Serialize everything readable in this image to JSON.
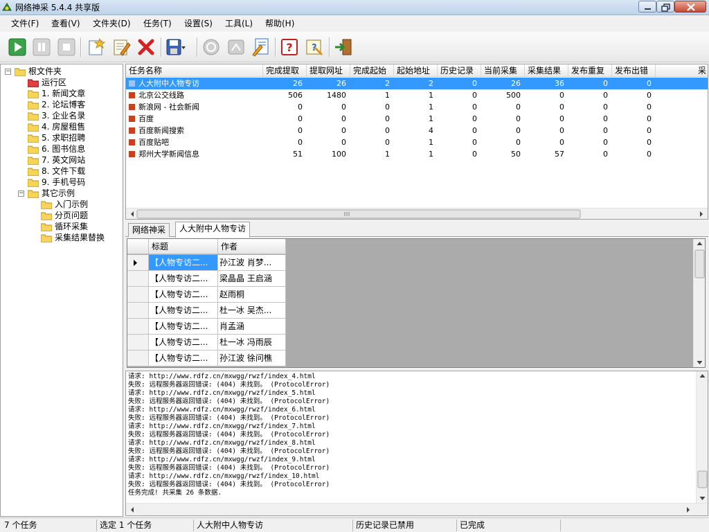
{
  "window": {
    "title": "网络神采 5.4.4 共享版"
  },
  "menu": [
    {
      "label": "文件(F)"
    },
    {
      "label": "查看(V)"
    },
    {
      "label": "文件夹(D)"
    },
    {
      "label": "任务(T)"
    },
    {
      "label": "设置(S)"
    },
    {
      "label": "工具(L)"
    },
    {
      "label": "帮助(H)"
    }
  ],
  "toolbar_icons": [
    "start-icon",
    "pause-icon",
    "stop-icon",
    "new-task-icon",
    "edit-task-icon",
    "delete-task-icon",
    "save-icon",
    "disabled-run-icon",
    "disabled-export-icon",
    "wizard-icon",
    "help-icon",
    "search-help-icon",
    "exit-icon"
  ],
  "tree": {
    "root": "根文件夹",
    "items": [
      {
        "label": "运行区"
      },
      {
        "label": "1. 新闻文章"
      },
      {
        "label": "2. 论坛博客"
      },
      {
        "label": "3. 企业名录"
      },
      {
        "label": "4. 房屋租售"
      },
      {
        "label": "5. 求职招聘"
      },
      {
        "label": "6. 图书信息"
      },
      {
        "label": "7. 英文网站"
      },
      {
        "label": "8. 文件下载"
      },
      {
        "label": "9. 手机号码"
      }
    ],
    "other": "其它示例",
    "sub_items": [
      {
        "label": "入门示例"
      },
      {
        "label": "分页问题"
      },
      {
        "label": "循环采集"
      },
      {
        "label": "采集结果替换"
      }
    ]
  },
  "task_table": {
    "columns": [
      "任务名称",
      "完成提取",
      "提取网址",
      "完成起始",
      "起始地址",
      "历史记录",
      "当前采集",
      "采集结果",
      "发布重复",
      "发布出错",
      "采"
    ],
    "rows": [
      [
        "人大附中人物专访",
        "26",
        "26",
        "2",
        "2",
        "0",
        "26",
        "36",
        "0",
        "0"
      ],
      [
        "北京公交线路",
        "506",
        "1480",
        "1",
        "1",
        "0",
        "500",
        "0",
        "0",
        "0"
      ],
      [
        "新浪网 - 社会新闻",
        "0",
        "0",
        "0",
        "1",
        "0",
        "0",
        "0",
        "0",
        "0"
      ],
      [
        "百度",
        "0",
        "0",
        "0",
        "1",
        "0",
        "0",
        "0",
        "0",
        "0"
      ],
      [
        "百度新闻搜索",
        "0",
        "0",
        "0",
        "4",
        "0",
        "0",
        "0",
        "0",
        "0"
      ],
      [
        "百度贴吧",
        "0",
        "0",
        "0",
        "1",
        "0",
        "0",
        "0",
        "0",
        "0"
      ],
      [
        "郑州大学新闻信息",
        "51",
        "100",
        "1",
        "1",
        "0",
        "50",
        "57",
        "0",
        "0"
      ]
    ]
  },
  "tabs": [
    {
      "label": "网络神采"
    },
    {
      "label": "人大附中人物专访"
    }
  ],
  "result_table": {
    "columns": [
      "标题",
      "作者"
    ],
    "rows": [
      [
        "【人物专访二...",
        "孙江波  肖梦..."
      ],
      [
        "【人物专访二...",
        "梁晶晶 王启涵"
      ],
      [
        "【人物专访二...",
        "赵雨桐"
      ],
      [
        "【人物专访二...",
        "杜一冰 吴杰..."
      ],
      [
        "【人物专访二...",
        "肖孟涵"
      ],
      [
        "【人物专访二...",
        "杜一冰  冯雨辰"
      ],
      [
        "【人物专访二...",
        "孙江波 徐问樵"
      ]
    ]
  },
  "log": [
    "请求: http://www.rdfz.cn/mxwgg/rwzf/index_4.html",
    "失败: 远程服务器返回错误: (404) 未找到。 (ProtocolError)",
    "请求: http://www.rdfz.cn/mxwgg/rwzf/index_5.html",
    "失败: 远程服务器返回错误: (404) 未找到。 (ProtocolError)",
    "请求: http://www.rdfz.cn/mxwgg/rwzf/index_6.html",
    "失败: 远程服务器返回错误: (404) 未找到。 (ProtocolError)",
    "请求: http://www.rdfz.cn/mxwgg/rwzf/index_7.html",
    "失败: 远程服务器返回错误: (404) 未找到。 (ProtocolError)",
    "请求: http://www.rdfz.cn/mxwgg/rwzf/index_8.html",
    "失败: 远程服务器返回错误: (404) 未找到。 (ProtocolError)",
    "请求: http://www.rdfz.cn/mxwgg/rwzf/index_9.html",
    "失败: 远程服务器返回错误: (404) 未找到。 (ProtocolError)",
    "请求: http://www.rdfz.cn/mxwgg/rwzf/index_10.html",
    "失败: 远程服务器返回错误: (404) 未找到。 (ProtocolError)",
    "任务完成! 共采集 26 条数据."
  ],
  "status": [
    "7 个任务",
    "选定 1 个任务",
    "人大附中人物专访",
    "历史记录已禁用",
    "已完成"
  ],
  "colors": {
    "selection": "#3399ff",
    "task_marker": "#c8401e"
  }
}
